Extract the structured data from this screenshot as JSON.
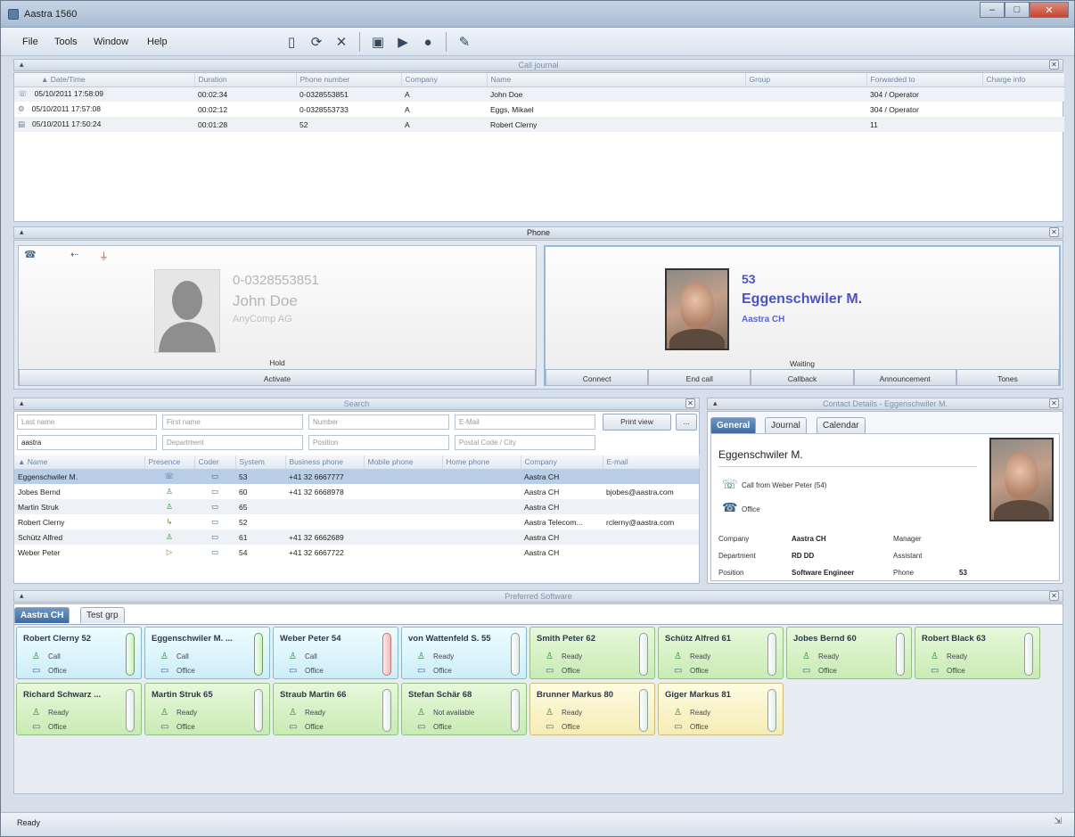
{
  "window": {
    "title": "Aastra 1560"
  },
  "menu": [
    "File",
    "Tools",
    "Window",
    "Help"
  ],
  "toolbar_icons": [
    "document-icon",
    "refresh-icon",
    "tools-icon",
    "contacts-icon",
    "forward-icon",
    "presence-icon",
    "settings-icon"
  ],
  "call_journal": {
    "title": "Call journal",
    "columns": [
      "▲ Date/Time",
      "Duration",
      "Phone number",
      "Company",
      "Name",
      "Group",
      "Forwarded to",
      "Charge info"
    ],
    "rows": [
      {
        "date": "05/10/2011 17:58:09",
        "duration": "00:02:34",
        "phone": "0-0328553851",
        "company": "A",
        "name": "John Doe",
        "group": "",
        "forwarded": "304 / Operator",
        "charge": ""
      },
      {
        "date": "05/10/2011 17:57:08",
        "duration": "00:02:12",
        "phone": "0-0328553733",
        "company": "A",
        "name": "Eggs, Mikael",
        "group": "",
        "forwarded": "304 / Operator",
        "charge": ""
      },
      {
        "date": "05/10/2011 17:50:24",
        "duration": "00:01:28",
        "phone": "52",
        "company": "A",
        "name": "Robert Clerny",
        "group": "",
        "forwarded": "11",
        "charge": ""
      }
    ]
  },
  "phone": {
    "title": "Phone",
    "left": {
      "number": "0-0328553851",
      "name": "John Doe",
      "company": "AnyComp AG",
      "status": "Hold",
      "button": "Activate"
    },
    "right": {
      "number": "53",
      "name": "Eggenschwiler M.",
      "company": "Aastra CH",
      "status": "Waiting",
      "buttons": [
        "Connect",
        "End call",
        "Callback",
        "Announcement",
        "Tones"
      ]
    }
  },
  "search": {
    "title": "Search",
    "placeholders": [
      "Last name",
      "First name",
      "Number",
      "E-Mail",
      "Department",
      "Position",
      "Postal Code / City"
    ],
    "first_value": "aastra",
    "buttons": [
      "Print view",
      "..."
    ],
    "columns": [
      "▲ Name",
      "Presence",
      "Coder",
      "System",
      "Business phone",
      "Mobile phone",
      "Home phone",
      "Company",
      "E-mail"
    ],
    "rows": [
      {
        "name": "Eggenschwiler M.",
        "system": "53",
        "business": "+41 32 6667777",
        "company": "Aastra CH",
        "email": ""
      },
      {
        "name": "Jobes Bernd",
        "system": "60",
        "business": "+41 32 6668978",
        "company": "Aastra CH",
        "email": "bjobes@aastra.com"
      },
      {
        "name": "Martin Struk",
        "system": "65",
        "business": "",
        "company": "Aastra CH",
        "email": ""
      },
      {
        "name": "Robert Clerny",
        "system": "52",
        "business": "",
        "company": "Aastra Telecom...",
        "email": "rclerny@aastra.com"
      },
      {
        "name": "Schütz Alfred",
        "system": "61",
        "business": "+41 32 6662689",
        "company": "Aastra CH",
        "email": ""
      },
      {
        "name": "Weber Peter",
        "system": "54",
        "business": "+41 32 6667722",
        "company": "Aastra CH",
        "email": ""
      }
    ]
  },
  "contact": {
    "title": "Contact Details - Eggenschwiler M.",
    "tabs": [
      "General",
      "Journal",
      "Calendar"
    ],
    "name": "Eggenschwiler M.",
    "call_status": "Call from Weber Peter (54)",
    "location": "Office",
    "fields": {
      "company_label": "Company",
      "company": "Aastra CH",
      "manager_label": "Manager",
      "manager": "",
      "department_label": "Department",
      "department": "RD DD",
      "assistant_label": "Assistant",
      "assistant": "",
      "position_label": "Position",
      "position": "Software Engineer",
      "phone_label": "Phone",
      "phone": "53"
    }
  },
  "favorites": {
    "title": "Preferred Software",
    "tabs": [
      "Aastra CH",
      "Test grp"
    ],
    "tiles": [
      {
        "name": "Robert Clerny 52",
        "presence": "Call",
        "location": "Office",
        "color": "blue",
        "bar": "green"
      },
      {
        "name": "Eggenschwiler M. ...",
        "presence": "Call",
        "location": "Office",
        "color": "blue",
        "bar": "green"
      },
      {
        "name": "Weber Peter 54",
        "presence": "Call",
        "location": "Office",
        "color": "blue",
        "bar": "red"
      },
      {
        "name": "von Wattenfeld S. 55",
        "presence": "Ready",
        "location": "Office",
        "color": "blue",
        "bar": "plain"
      },
      {
        "name": "Smith Peter 62",
        "presence": "Ready",
        "location": "Office",
        "color": "green",
        "bar": "plain"
      },
      {
        "name": "Schütz Alfred 61",
        "presence": "Ready",
        "location": "Office",
        "color": "green",
        "bar": "plain"
      },
      {
        "name": "Jobes Bernd 60",
        "presence": "Ready",
        "location": "Office",
        "color": "green",
        "bar": "plain"
      },
      {
        "name": "Robert Black 63",
        "presence": "Ready",
        "location": "Office",
        "color": "green",
        "bar": "plain"
      },
      {
        "name": "Richard Schwarz ...",
        "presence": "Ready",
        "location": "Office",
        "color": "green",
        "bar": "plain"
      },
      {
        "name": "Martin Struk 65",
        "presence": "Ready",
        "location": "Office",
        "color": "green",
        "bar": "plain"
      },
      {
        "name": "Straub Martin 66",
        "presence": "Ready",
        "location": "Office",
        "color": "green",
        "bar": "plain"
      },
      {
        "name": "Stefan Schär 68",
        "presence": "Not available",
        "location": "Office",
        "color": "green",
        "bar": "plain"
      },
      {
        "name": "Brunner Markus 80",
        "presence": "Ready",
        "location": "Office",
        "color": "yellow",
        "bar": "plain"
      },
      {
        "name": "Giger Markus 81",
        "presence": "Ready",
        "location": "Office",
        "color": "yellow",
        "bar": "plain"
      }
    ]
  },
  "status": {
    "text": "Ready"
  }
}
